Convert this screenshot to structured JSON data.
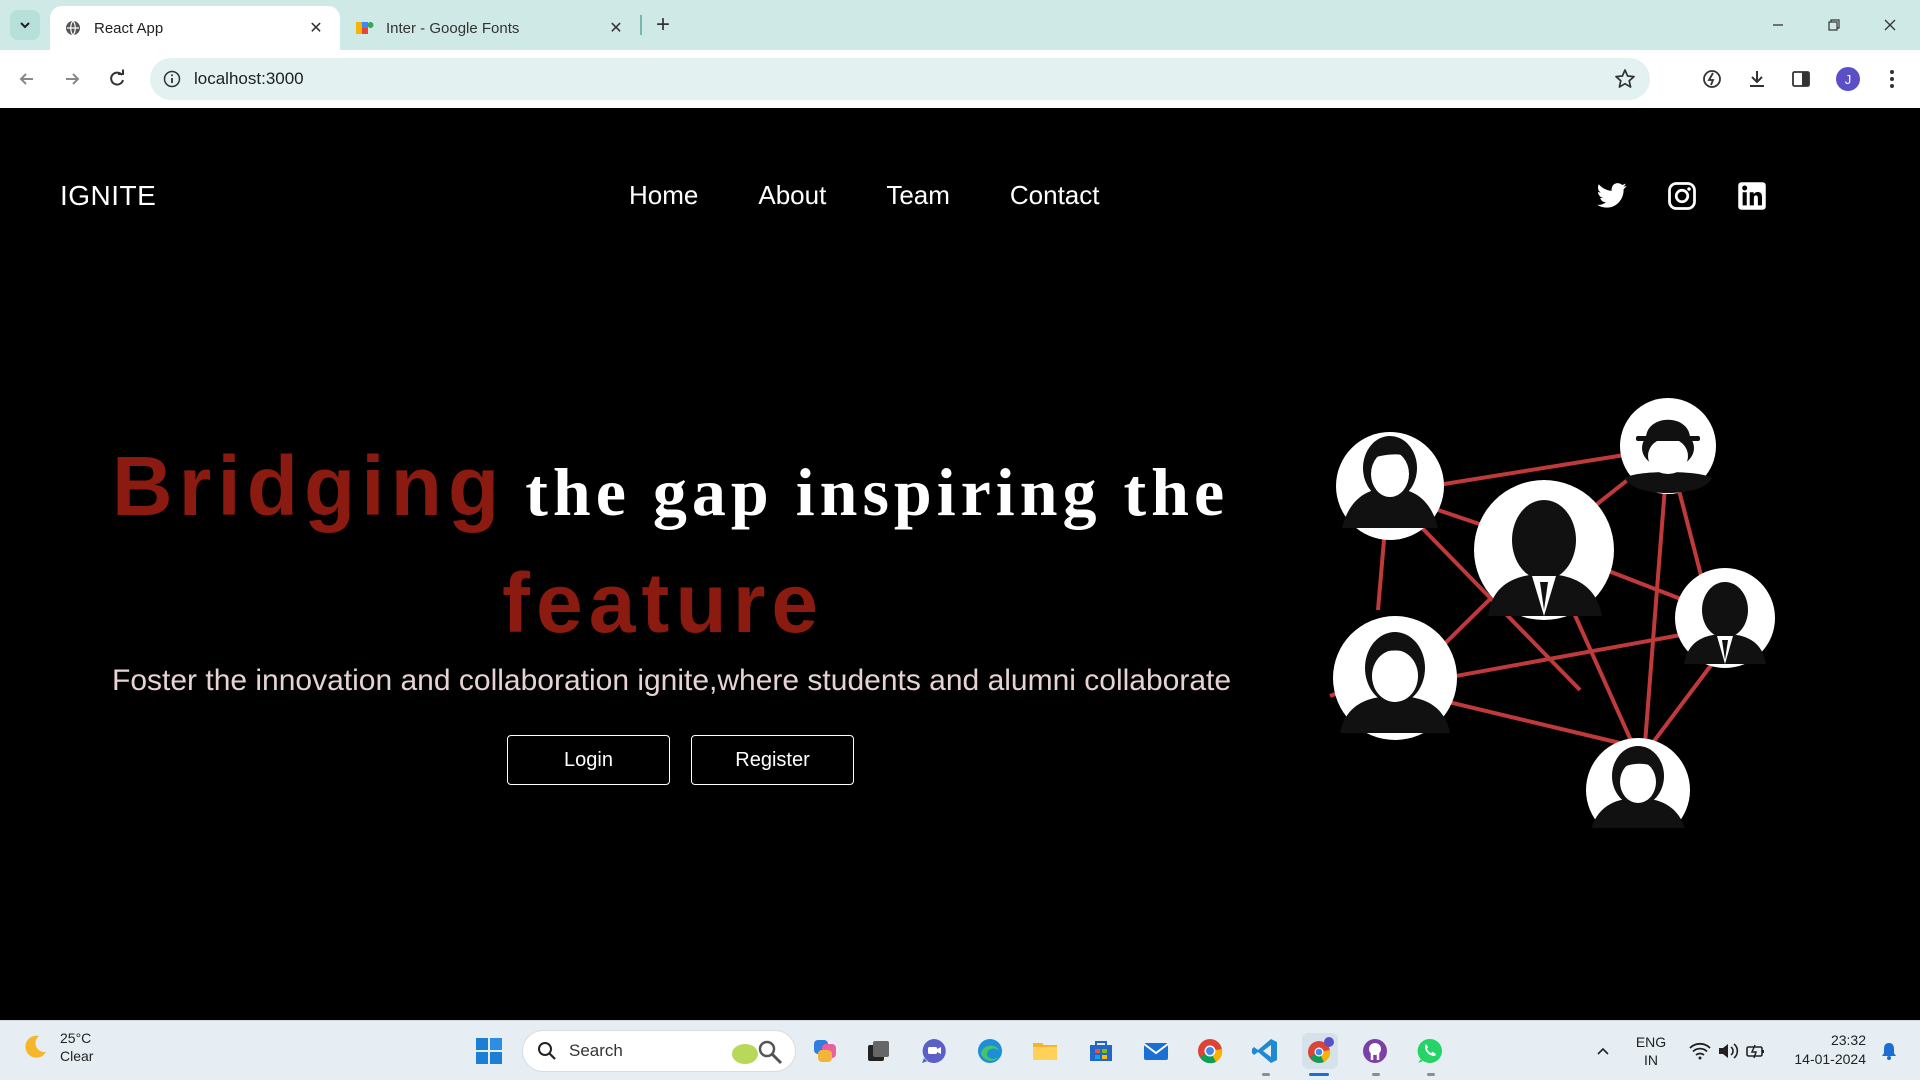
{
  "browser": {
    "tabs": [
      {
        "title": "React App",
        "active": true
      },
      {
        "title": "Inter - Google Fonts",
        "active": false
      }
    ],
    "url": "localhost:3000",
    "profile_initial": "J"
  },
  "site": {
    "brand": "IGNITE",
    "nav": [
      "Home",
      "About",
      "Team",
      "Contact"
    ],
    "social": [
      "twitter-icon",
      "instagram-icon",
      "linkedin-icon"
    ],
    "headline": {
      "red_word": "Bridging",
      "white_text": "the gap inspiring the",
      "red_word_2": "feature"
    },
    "subtitle": "Foster the innovation and collaboration ignite,where students and alumni collaborate",
    "buttons": {
      "login": "Login",
      "register": "Register"
    },
    "colors": {
      "accent": "#8b1a10",
      "network_line": "#c0393b"
    }
  },
  "taskbar": {
    "weather": {
      "temp": "25°C",
      "condition": "Clear"
    },
    "search_placeholder": "Search",
    "language": {
      "line1": "ENG",
      "line2": "IN"
    },
    "time": "23:32",
    "date": "14-01-2024"
  }
}
